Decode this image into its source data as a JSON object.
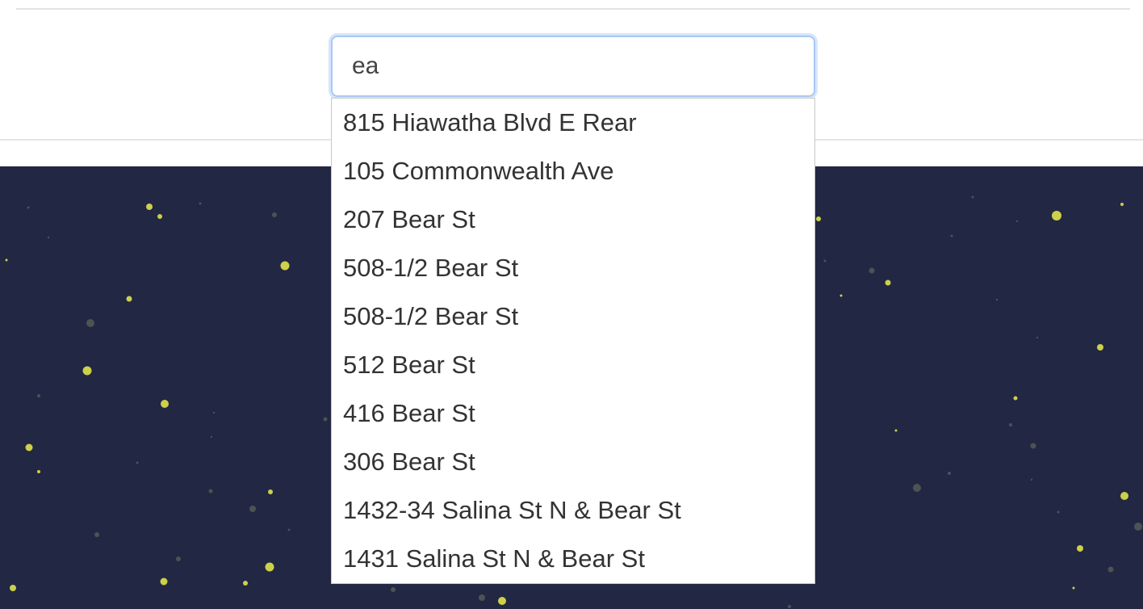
{
  "search": {
    "value": "ea"
  },
  "suggestions": [
    "815 Hiawatha Blvd E Rear",
    "105 Commonwealth Ave",
    "207 Bear St",
    "508-1/2 Bear St",
    "508-1/2 Bear St",
    "512 Bear St",
    "416 Bear St",
    "306 Bear St",
    "1432-34 Salina St N & Bear St",
    "1431 Salina St N & Bear St"
  ],
  "colors": {
    "background_dark": "#222744",
    "star_yellow": "#d7d94a",
    "star_dim": "#6b6f5e",
    "input_focus_border": "#a9c8f3"
  }
}
